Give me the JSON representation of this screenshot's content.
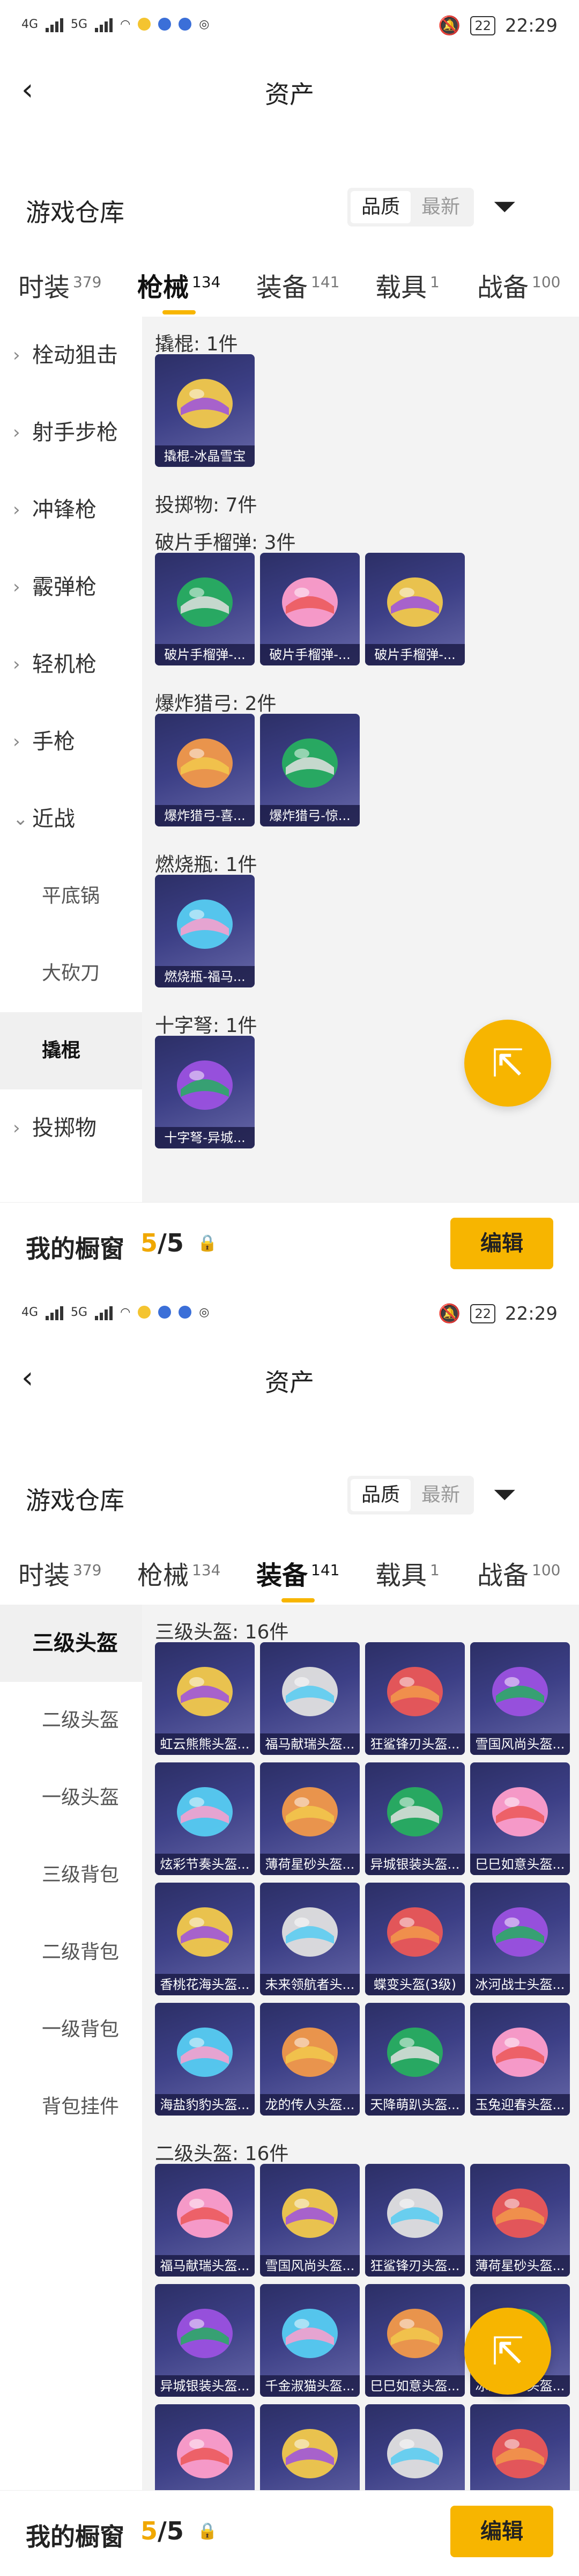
{
  "status": {
    "time": "22:29",
    "battery": "22",
    "net_left": "4G",
    "net_right": "5G"
  },
  "header": {
    "back_icon": "chevron-left-icon",
    "title": "资产"
  },
  "warehouse": {
    "title": "游戏仓库",
    "sort_options": [
      "品质",
      "最新"
    ],
    "sort_selected": "品质",
    "filter_icon": "filter-icon"
  },
  "tabs": [
    {
      "label": "时装",
      "count": "379"
    },
    {
      "label": "枪械",
      "count": "134"
    },
    {
      "label": "装备",
      "count": "141"
    },
    {
      "label": "载具",
      "count": "1"
    },
    {
      "label": "战备",
      "count": "100"
    }
  ],
  "screen1": {
    "active_tab": "枪械",
    "sidebar": [
      {
        "label": "栓动狙击",
        "chev": "›"
      },
      {
        "label": "射手步枪",
        "chev": "›"
      },
      {
        "label": "冲锋枪",
        "chev": "›"
      },
      {
        "label": "霰弹枪",
        "chev": "›"
      },
      {
        "label": "轻机枪",
        "chev": "›"
      },
      {
        "label": "手枪",
        "chev": "›"
      },
      {
        "label": "近战",
        "chev": "⌄"
      },
      {
        "label": "平底锅",
        "chev": ""
      },
      {
        "label": "大砍刀",
        "chev": ""
      },
      {
        "label": "撬棍",
        "chev": ""
      },
      {
        "label": "投掷物",
        "chev": "›"
      }
    ],
    "sidebar_selected": "撬棍",
    "groups": [
      {
        "heading": "撬棍: 1件",
        "items": [
          "撬棍-冰晶雪宝"
        ]
      },
      {
        "heading": "投掷物: 7件",
        "items": []
      },
      {
        "heading": "破片手榴弹: 3件",
        "items": [
          "破片手榴弹-...",
          "破片手榴弹-...",
          "破片手榴弹-..."
        ]
      },
      {
        "heading": "爆炸猎弓: 2件",
        "items": [
          "爆炸猎弓-喜...",
          "爆炸猎弓-惊..."
        ]
      },
      {
        "heading": "燃烧瓶: 1件",
        "items": [
          "燃烧瓶-福马..."
        ]
      },
      {
        "heading": "十字弩: 1件",
        "items": [
          "十字弩-异城..."
        ]
      }
    ]
  },
  "screen2": {
    "active_tab": "装备",
    "sidebar": [
      {
        "label": "三级头盔"
      },
      {
        "label": "二级头盔"
      },
      {
        "label": "一级头盔"
      },
      {
        "label": "三级背包"
      },
      {
        "label": "二级背包"
      },
      {
        "label": "一级背包"
      },
      {
        "label": "背包挂件"
      }
    ],
    "sidebar_selected": "三级头盔",
    "groups": [
      {
        "heading": "三级头盔: 16件",
        "items": [
          "虹云熊熊头盔...",
          "福马献瑞头盔...",
          "狂鲨锋刃头盔...",
          "雪国风尚头盔...",
          "炫彩节奏头盔...",
          "薄荷星砂头盔...",
          "异城银装头盔...",
          "巳巳如意头盔...",
          "香桃花海头盔...",
          "未来领航者头...",
          "蝶变头盔(3级)",
          "冰河战士头盔...",
          "海盐豹豹头盔...",
          "龙的传人头盔...",
          "天降萌趴头盔...",
          "玉兔迎春头盔..."
        ]
      },
      {
        "heading": "二级头盔: 16件",
        "items": [
          "福马献瑞头盔...",
          "雪国风尚头盔...",
          "狂鲨锋刃头盔...",
          "薄荷星砂头盔...",
          "异城银装头盔...",
          "千金淑猫头盔...",
          "巳巳如意头盔...",
          "冰河战士头盔...",
          "",
          "",
          "",
          ""
        ]
      }
    ]
  },
  "footer": {
    "label": "我的橱窗",
    "count_used": "5",
    "count_sep": "/",
    "count_total": "5",
    "lock_icon": "lock-icon",
    "edit_label": "编辑"
  },
  "fab": {
    "icon": "share-external-icon"
  },
  "colors": {
    "accent": "#f7b500",
    "card_bg": "#3c3f86",
    "panel_bg": "#f3f3f3"
  }
}
